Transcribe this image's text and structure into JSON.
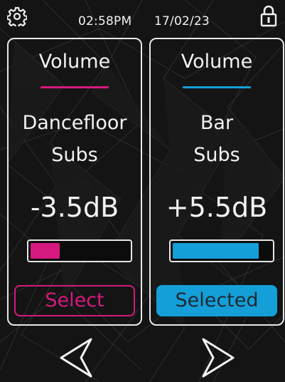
{
  "status_bar": {
    "time": "02:58PM",
    "date": "17/02/23",
    "settings_icon": "gear-icon",
    "lock_icon": "padlock-icon"
  },
  "panels": [
    {
      "title": "Volume",
      "name_line1": "Dancefloor",
      "name_line2": "Subs",
      "value": "-3.5dB",
      "level_percent": 30,
      "button_label": "Select",
      "selected": false,
      "accent": "#d6197e"
    },
    {
      "title": "Volume",
      "name_line1": "Bar",
      "name_line2": "Subs",
      "value": "+5.5dB",
      "level_percent": 88,
      "button_label": "Selected",
      "selected": true,
      "accent": "#159fd8"
    }
  ],
  "navigation": {
    "prev_icon": "chevron-left-icon",
    "next_icon": "chevron-right-icon"
  }
}
